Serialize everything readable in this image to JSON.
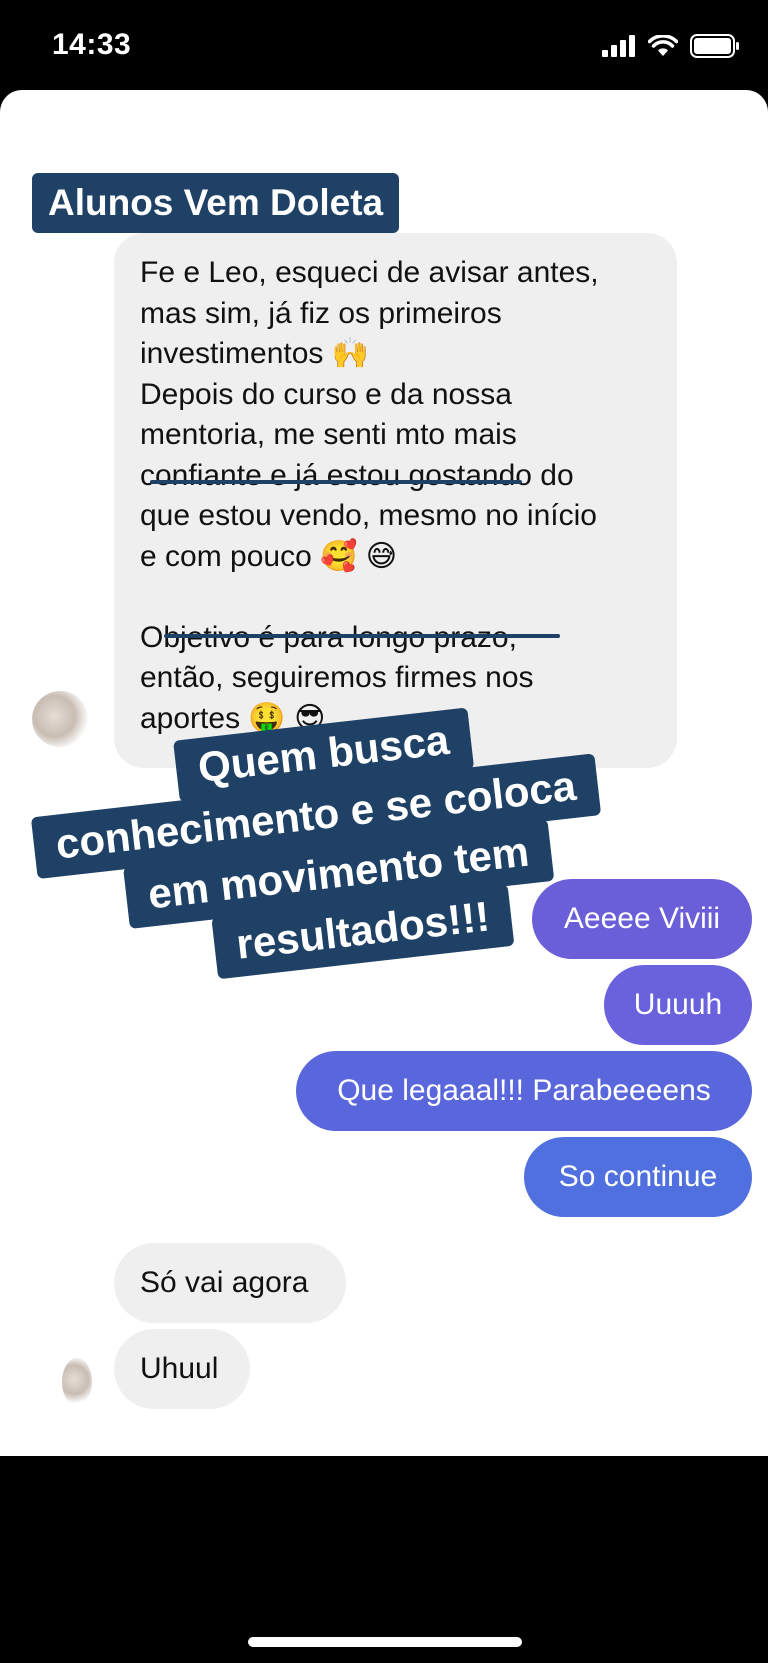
{
  "status_bar": {
    "time": "14:33"
  },
  "group_title": "Alunos Vem Doleta",
  "messages_left": {
    "long": "Fe e Leo, esqueci de avisar antes,\nmas sim, já fiz os primeiros\ninvestimentos 🙌\nDepois do curso e da nossa\nmentoria, me senti mto mais\nconfiante e já estou gostando do\nque estou vendo, mesmo no início\ne com pouco 🥰 😅\n\nObjetivo é para longo prazo,\nentão, seguiremos firmes nos\naportes 🤑 😎",
    "short1": "Só vai agora",
    "short2": "Uhuul"
  },
  "banner_lines": [
    "Quem busca",
    "conhecimento e se coloca",
    "em movimento tem",
    "resultados!!!"
  ],
  "messages_right": [
    {
      "text": "Aeeee Viviii",
      "color": "#6a5fd9"
    },
    {
      "text": "Uuuuh",
      "color": "#6a61dc"
    },
    {
      "text": "Que legaaal!!! Parabeeeens",
      "color": "#5a67dc"
    },
    {
      "text": "So continue",
      "color": "#4f70de"
    }
  ],
  "colors": {
    "banner": "#1f4166",
    "bubble_left": "#efefef",
    "background": "#000000",
    "card": "#ffffff"
  }
}
